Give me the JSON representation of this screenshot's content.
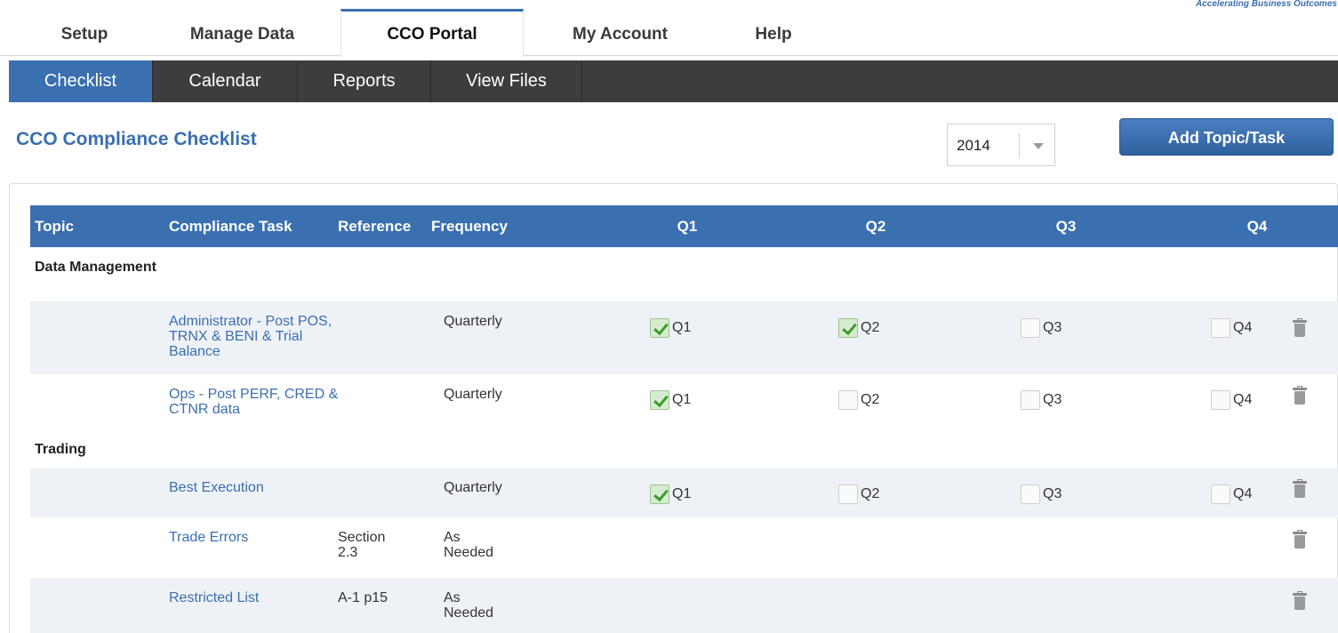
{
  "header": {
    "tagline": "Accelerating Business Outcomes"
  },
  "top_nav": [
    {
      "label": "Setup"
    },
    {
      "label": "Manage Data"
    },
    {
      "label": "CCO Portal",
      "active": true
    },
    {
      "label": "My Account"
    },
    {
      "label": "Help"
    }
  ],
  "sub_nav": [
    {
      "label": "Checklist",
      "active": true
    },
    {
      "label": "Calendar"
    },
    {
      "label": "Reports"
    },
    {
      "label": "View Files"
    }
  ],
  "page": {
    "title": "CCO Compliance Checklist",
    "year": "2014",
    "add_button": "Add Topic/Task"
  },
  "table": {
    "columns": {
      "topic": "Topic",
      "task": "Compliance Task",
      "reference": "Reference",
      "frequency": "Frequency",
      "q1": "Q1",
      "q2": "Q2",
      "q3": "Q3",
      "q4": "Q4"
    },
    "groups": [
      {
        "topic": "Data Management",
        "tasks": [
          {
            "task": "Administrator - Post POS, TRNX & BENI & Trial Balance",
            "reference": "",
            "frequency": "Quarterly",
            "quarters": [
              true,
              true,
              false,
              false
            ]
          },
          {
            "task": "Ops - Post PERF, CRED & CTNR data",
            "reference": "",
            "frequency": "Quarterly",
            "quarters": [
              true,
              false,
              false,
              false
            ]
          }
        ]
      },
      {
        "topic": "Trading",
        "tasks": [
          {
            "task": "Best Execution",
            "reference": "",
            "frequency": "Quarterly",
            "quarters": [
              true,
              false,
              false,
              false
            ]
          },
          {
            "task": "Trade Errors",
            "reference": "Section 2.3",
            "frequency": "As Needed",
            "quarters": null
          },
          {
            "task": "Restricted List",
            "reference": "A-1 p15",
            "frequency": "As Needed",
            "quarters": null
          }
        ]
      }
    ]
  },
  "colors": {
    "accent": "#3a6fb0",
    "subnav": "#3d3d3d",
    "check": "#3d9a2d"
  }
}
